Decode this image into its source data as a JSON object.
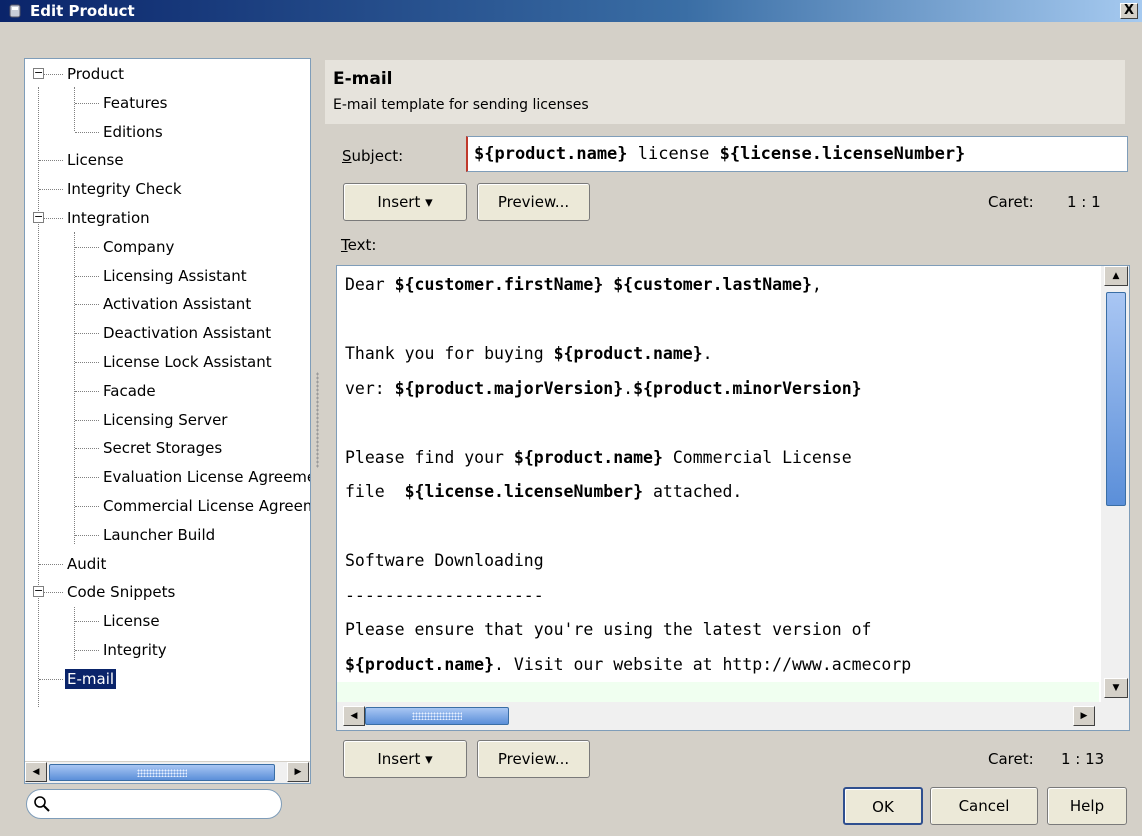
{
  "window": {
    "title": "Edit Product",
    "close_label": "X"
  },
  "tree": {
    "items": [
      {
        "label": "Product"
      },
      {
        "label": "Features"
      },
      {
        "label": "Editions"
      },
      {
        "label": "License"
      },
      {
        "label": "Integrity Check"
      },
      {
        "label": "Integration"
      },
      {
        "label": "Company"
      },
      {
        "label": "Licensing Assistant"
      },
      {
        "label": "Activation Assistant"
      },
      {
        "label": "Deactivation Assistant"
      },
      {
        "label": "License Lock Assistant"
      },
      {
        "label": "Facade"
      },
      {
        "label": "Licensing Server"
      },
      {
        "label": "Secret Storages"
      },
      {
        "label": "Evaluation License Agreement"
      },
      {
        "label": "Commercial License Agreement"
      },
      {
        "label": "Launcher Build"
      },
      {
        "label": "Audit"
      },
      {
        "label": "Code Snippets"
      },
      {
        "label": "License"
      },
      {
        "label": "Integrity"
      },
      {
        "label": "E-mail"
      }
    ],
    "selected": "E-mail"
  },
  "search": {
    "placeholder": ""
  },
  "panel": {
    "title": "E-mail",
    "subtitle": "E-mail template for sending licenses"
  },
  "subject": {
    "label_mnemonic": "S",
    "label_rest": "ubject:",
    "parts": [
      {
        "text": "${product.name}",
        "bold": true
      },
      {
        "text": " license ",
        "bold": false
      },
      {
        "text": "${license.licenseNumber}",
        "bold": true
      }
    ]
  },
  "subject_toolbar": {
    "insert_label": "Insert ▾",
    "preview_label": "Preview...",
    "caret_label": "Caret:",
    "caret_value": "1 : 1"
  },
  "text": {
    "label_mnemonic": "T",
    "label_rest": "ext:",
    "lines": [
      [
        {
          "text": "Dear ",
          "bold": false
        },
        {
          "text": "${customer.firstName}",
          "bold": true
        },
        {
          "text": " ",
          "bold": false
        },
        {
          "text": "${customer.lastName}",
          "bold": true
        },
        {
          "text": ",",
          "bold": false
        }
      ],
      [],
      [
        {
          "text": "Thank you for buying ",
          "bold": false
        },
        {
          "text": "${product.name}",
          "bold": true
        },
        {
          "text": ".",
          "bold": false
        }
      ],
      [
        {
          "text": "ver: ",
          "bold": false
        },
        {
          "text": "${product.majorVersion}",
          "bold": true
        },
        {
          "text": ".",
          "bold": false
        },
        {
          "text": "${product.minorVersion}",
          "bold": true
        }
      ],
      [],
      [
        {
          "text": "Please find your ",
          "bold": false
        },
        {
          "text": "${product.name}",
          "bold": true
        },
        {
          "text": " Commercial License",
          "bold": false
        }
      ],
      [
        {
          "text": "file  ",
          "bold": false
        },
        {
          "text": "${license.licenseNumber}",
          "bold": true
        },
        {
          "text": " attached.",
          "bold": false
        }
      ],
      [],
      [
        {
          "text": "Software Downloading",
          "bold": false
        }
      ],
      [
        {
          "text": "--------------------",
          "bold": false
        }
      ],
      [
        {
          "text": "Please ensure that you're using the latest version of",
          "bold": false
        }
      ],
      [
        {
          "text": "${product.name}",
          "bold": true
        },
        {
          "text": ". Visit our website at http://www.acmecorp",
          "bold": false
        }
      ],
      []
    ],
    "current_line": 12
  },
  "text_toolbar": {
    "insert_label": "Insert ▾",
    "preview_label": "Preview...",
    "caret_label": "Caret:",
    "caret_value": "1 : 13"
  },
  "dialog_buttons": {
    "ok": "OK",
    "cancel": "Cancel",
    "help": "Help"
  },
  "colors": {
    "titlebar_start": "#0a246a",
    "selection": "#0a246a",
    "scroll_thumb": "#5b8fd9",
    "current_line": "#f0fff0"
  }
}
